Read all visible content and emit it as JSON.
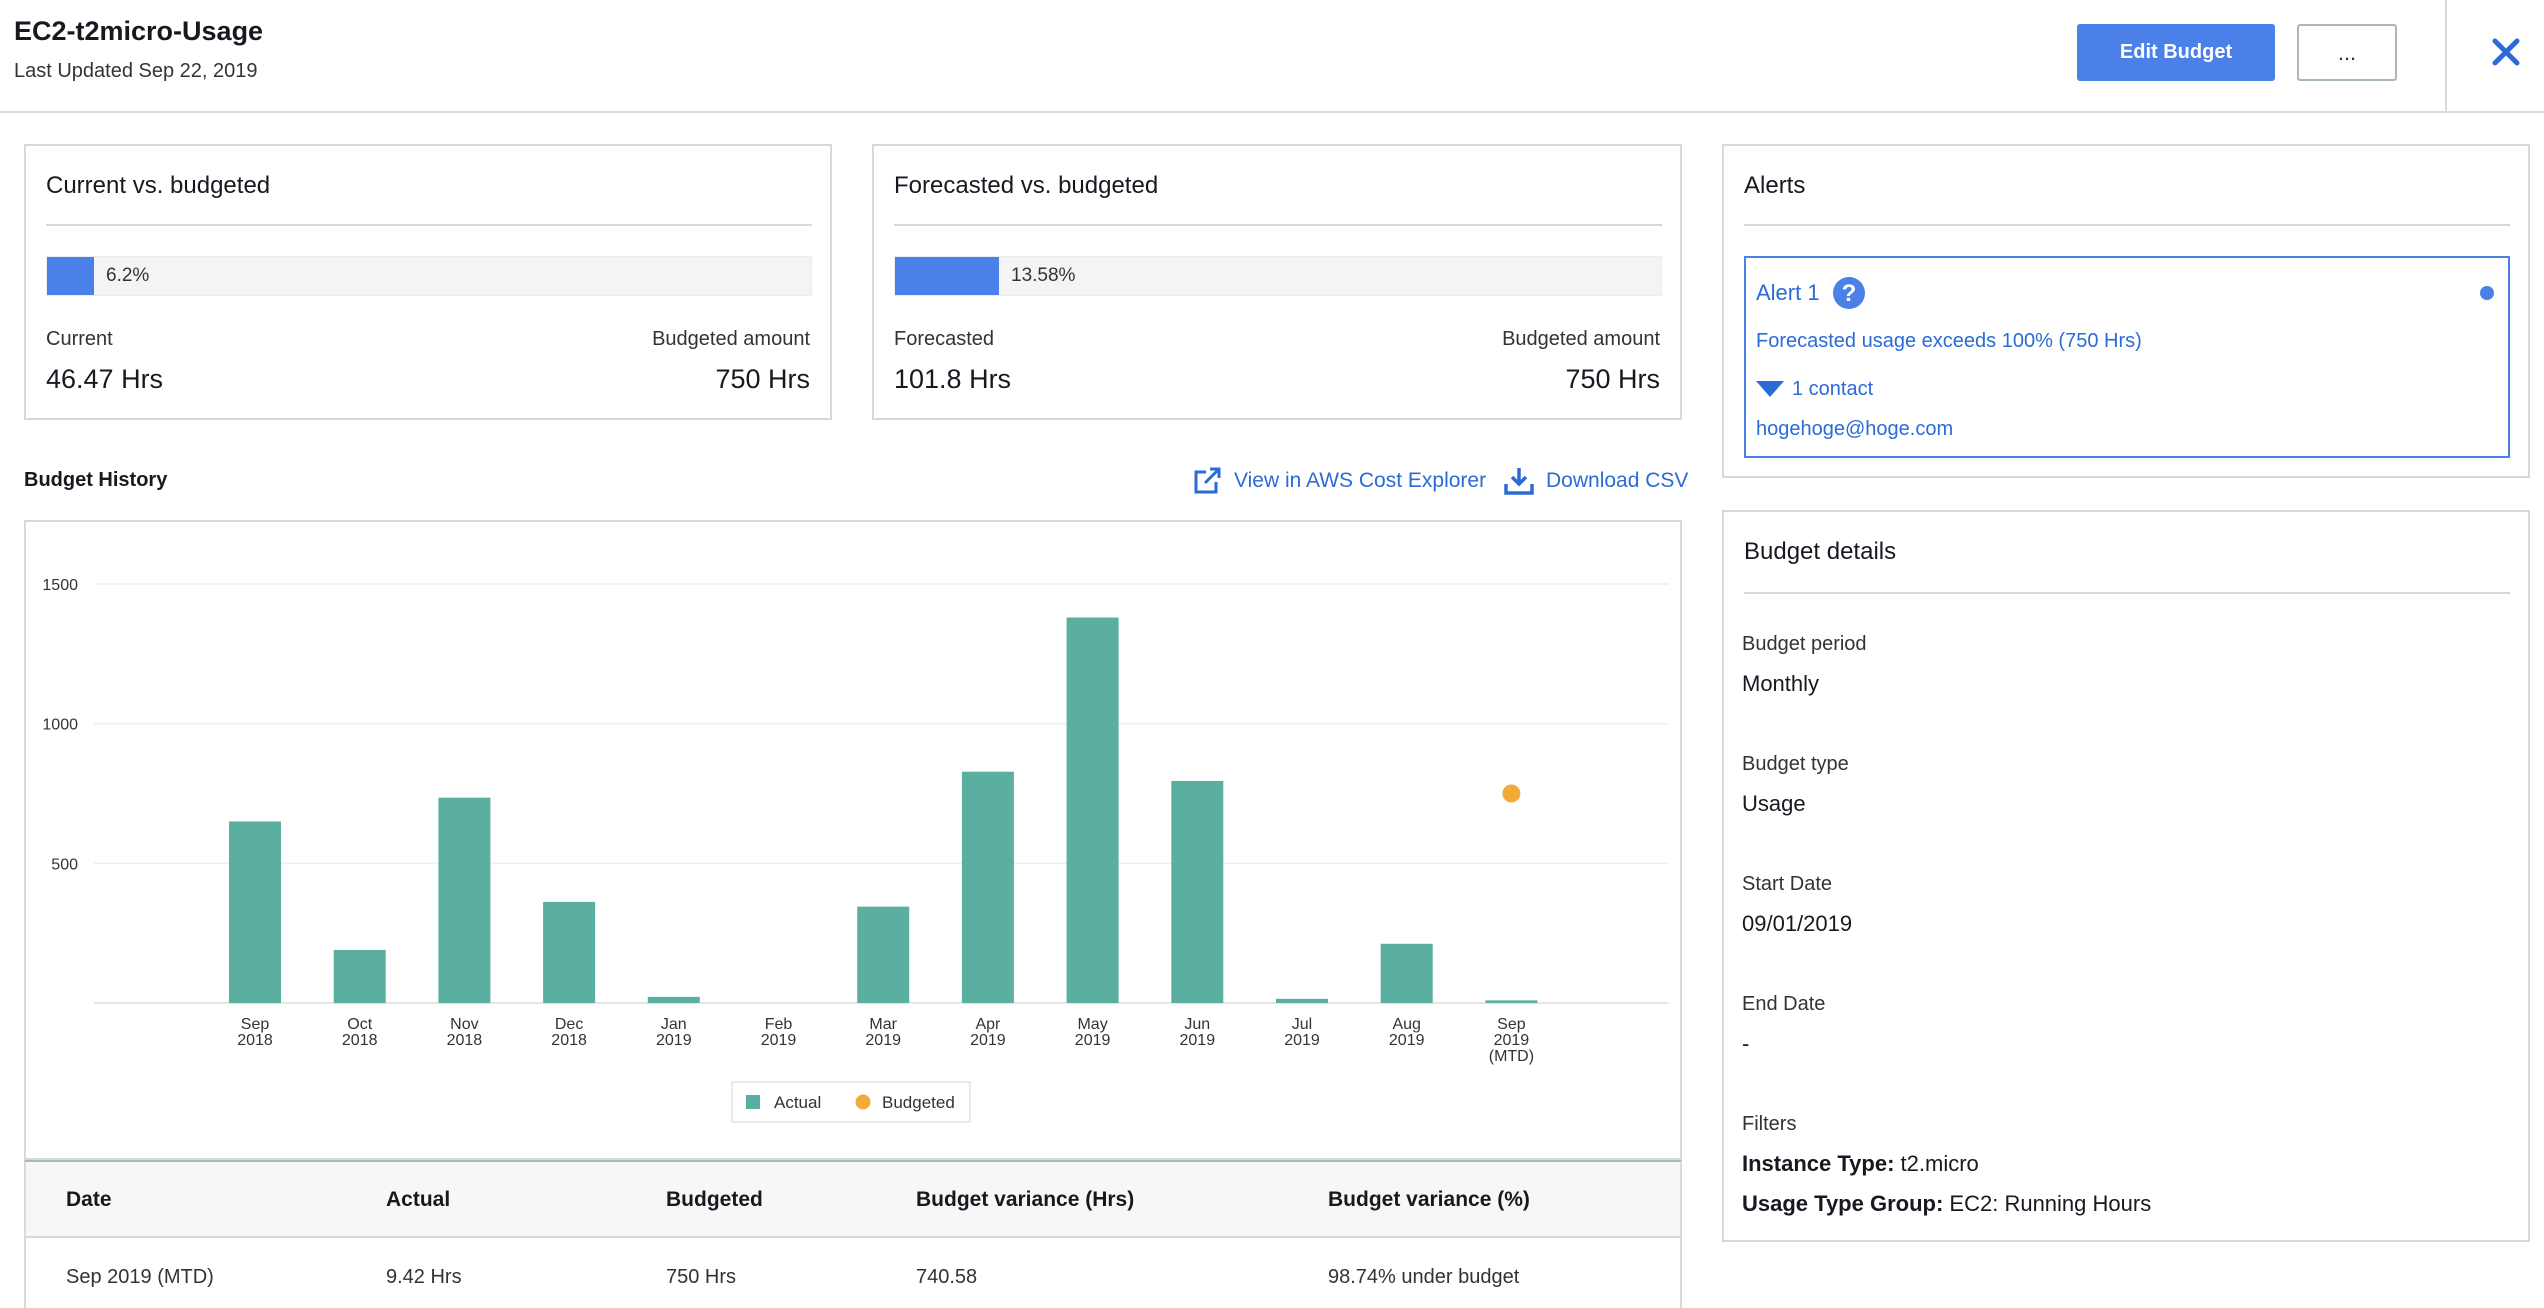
{
  "header": {
    "title": "EC2-t2micro-Usage",
    "last_updated": "Last Updated Sep 22, 2019",
    "edit_label": "Edit Budget",
    "more_label": "...",
    "close_icon": "close-icon"
  },
  "current": {
    "title": "Current vs. budgeted",
    "percent": "6.2%",
    "percent_value": 6.2,
    "label_left": "Current",
    "value_left": "46.47 Hrs",
    "label_right": "Budgeted amount",
    "value_right": "750 Hrs"
  },
  "forecast": {
    "title": "Forecasted vs. budgeted",
    "percent": "13.58%",
    "percent_value": 13.58,
    "label_left": "Forecasted",
    "value_left": "101.8 Hrs",
    "label_right": "Budgeted amount",
    "value_right": "750 Hrs"
  },
  "alerts": {
    "title": "Alerts",
    "alert_name": "Alert 1",
    "description": "Forecasted usage exceeds 100% (750 Hrs)",
    "contacts_label": "1 contact",
    "contact_email": "hogehoge@hoge.com"
  },
  "history": {
    "title": "Budget History",
    "explorer_link": "View in AWS Cost Explorer",
    "csv_link": "Download CSV"
  },
  "chart_data": {
    "type": "bar",
    "categories": [
      [
        "Sep",
        "2018"
      ],
      [
        "Oct",
        "2018"
      ],
      [
        "Nov",
        "2018"
      ],
      [
        "Dec",
        "2018"
      ],
      [
        "Jan",
        "2019"
      ],
      [
        "Feb",
        "2019"
      ],
      [
        "Mar",
        "2019"
      ],
      [
        "Apr",
        "2019"
      ],
      [
        "May",
        "2019"
      ],
      [
        "Jun",
        "2019"
      ],
      [
        "Jul",
        "2019"
      ],
      [
        "Aug",
        "2019"
      ],
      [
        "Sep",
        "2019",
        "(MTD)"
      ]
    ],
    "series": [
      {
        "name": "Actual",
        "type": "bar",
        "color": "#5aafa0",
        "values": [
          650,
          190,
          735,
          362,
          22,
          0,
          345,
          828,
          1380,
          795,
          15,
          212,
          9.42
        ]
      },
      {
        "name": "Budgeted",
        "type": "point",
        "color": "#f0ac36",
        "values": [
          null,
          null,
          null,
          null,
          null,
          null,
          null,
          null,
          null,
          null,
          null,
          null,
          750
        ]
      }
    ],
    "yticks": [
      500,
      1000,
      1500
    ],
    "ylim": [
      0,
      1500
    ],
    "grid": true,
    "legend": "bottom-center"
  },
  "table": {
    "headers": [
      "Date",
      "Actual",
      "Budgeted",
      "Budget variance (Hrs)",
      "Budget variance (%)"
    ],
    "rows": [
      [
        "Sep 2019 (MTD)",
        "9.42 Hrs",
        "750 Hrs",
        "740.58",
        "98.74% under budget"
      ]
    ]
  },
  "details": {
    "title": "Budget details",
    "period_label": "Budget period",
    "period_value": "Monthly",
    "type_label": "Budget type",
    "type_value": "Usage",
    "start_label": "Start Date",
    "start_value": "09/01/2019",
    "end_label": "End Date",
    "end_value": "-",
    "filters_label": "Filters",
    "filter_instance_key": "Instance Type:",
    "filter_instance_value": "t2.micro",
    "filter_usage_key": "Usage Type Group:",
    "filter_usage_value": "EC2: Running Hours"
  },
  "colors": {
    "accent": "#4a80e8",
    "link": "#2b6bd7",
    "bar": "#5aafa0",
    "budget_point": "#f0ac36",
    "border": "#d5dbdb"
  }
}
